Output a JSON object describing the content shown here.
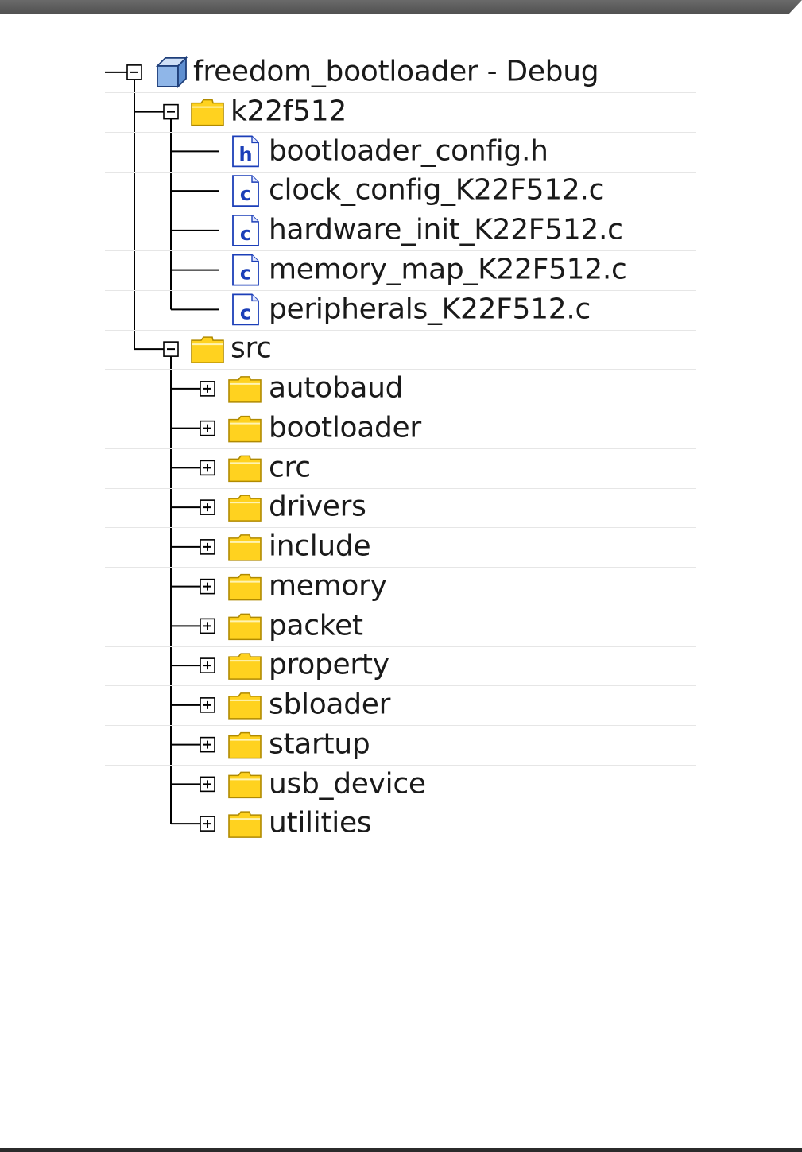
{
  "project": {
    "label": "freedom_bootloader - Debug",
    "icon": "project-icon",
    "expanded": true
  },
  "tree": [
    {
      "label": "k22f512",
      "type": "folder",
      "expanded": true,
      "children": [
        {
          "label": "bootloader_config.h",
          "type": "header-file"
        },
        {
          "label": "clock_config_K22F512.c",
          "type": "c-file"
        },
        {
          "label": "hardware_init_K22F512.c",
          "type": "c-file"
        },
        {
          "label": "memory_map_K22F512.c",
          "type": "c-file"
        },
        {
          "label": "peripherals_K22F512.c",
          "type": "c-file"
        }
      ]
    },
    {
      "label": "src",
      "type": "folder",
      "expanded": true,
      "children": [
        {
          "label": "autobaud",
          "type": "folder",
          "expanded": false
        },
        {
          "label": "bootloader",
          "type": "folder",
          "expanded": false
        },
        {
          "label": "crc",
          "type": "folder",
          "expanded": false
        },
        {
          "label": "drivers",
          "type": "folder",
          "expanded": false
        },
        {
          "label": "include",
          "type": "folder",
          "expanded": false
        },
        {
          "label": "memory",
          "type": "folder",
          "expanded": false
        },
        {
          "label": "packet",
          "type": "folder",
          "expanded": false
        },
        {
          "label": "property",
          "type": "folder",
          "expanded": false
        },
        {
          "label": "sbloader",
          "type": "folder",
          "expanded": false
        },
        {
          "label": "startup",
          "type": "folder",
          "expanded": false
        },
        {
          "label": "usb_device",
          "type": "folder",
          "expanded": false
        },
        {
          "label": "utilities",
          "type": "folder",
          "expanded": false
        }
      ]
    }
  ],
  "colors": {
    "folder": "#ffd21f",
    "folder_border": "#b08a00",
    "file_icon": "#1c3fb8",
    "guide": "#000000"
  }
}
